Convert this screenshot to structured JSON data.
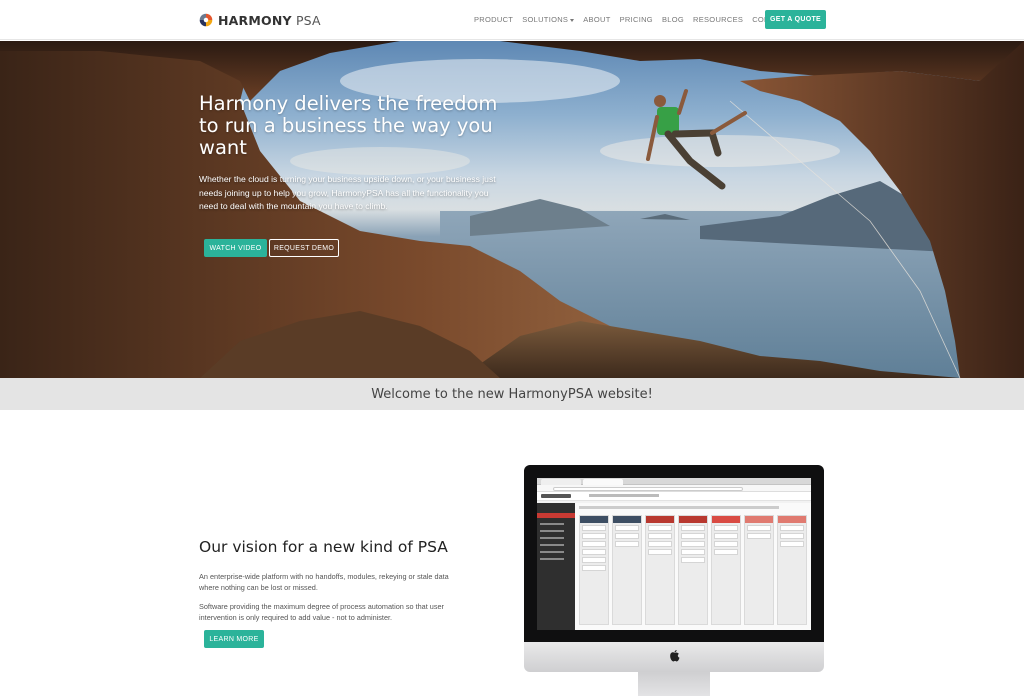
{
  "brand": {
    "name_bold": "HARMONY",
    "name_light": "PSA",
    "accent_color": "#2bb39a"
  },
  "nav": {
    "items": [
      {
        "label": "PRODUCT"
      },
      {
        "label": "SOLUTIONS",
        "has_dropdown": true
      },
      {
        "label": "ABOUT"
      },
      {
        "label": "PRICING"
      },
      {
        "label": "BLOG"
      },
      {
        "label": "RESOURCES"
      },
      {
        "label": "CONTACT"
      }
    ],
    "cta_label": "GET A QUOTE"
  },
  "hero": {
    "title": "Harmony delivers the freedom to run a business the way you want",
    "text": "Whether the cloud is turning your business upside down, or your business just needs joining up to help you grow, HarmonyPSA has all the functionality you need to deal with the mountain you have to climb.",
    "watch_label": "WATCH VIDEO",
    "demo_label": "REQUEST DEMO"
  },
  "welcome": {
    "text": "Welcome to the new HarmonyPSA website!"
  },
  "vision": {
    "title": "Our vision for a new kind of PSA",
    "p1": "An enterprise-wide platform with no handoffs, modules, rekeying or stale data where nothing can be lost or missed.",
    "p2": "Software providing the maximum degree of process automation so that user intervention is only required to add value - not to administer.",
    "learn_label": "LEARN MORE"
  },
  "icons": {
    "logo": "harmony-logo-icon",
    "caret": "chevron-down-icon",
    "apple": "apple-logo-icon"
  }
}
